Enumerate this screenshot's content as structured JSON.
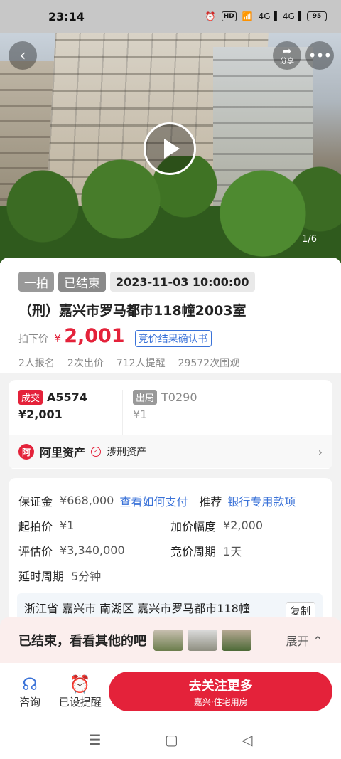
{
  "status_bar": {
    "time": "23:14",
    "hd": "HD",
    "battery": "95",
    "network1": "4G",
    "network2": "4G"
  },
  "hero": {
    "share_label": "分享",
    "counter": "1/6"
  },
  "auction": {
    "round_tag": "一拍",
    "status_tag": "已结束",
    "datetime": "2023-11-03 10:00:00",
    "title": "（刑）嘉兴市罗马都市118幢2003室",
    "price_label": "拍下价",
    "currency": "¥",
    "price": "2,001",
    "cert_link": "竞价结果确认书",
    "stats": [
      "2人报名",
      "2次出价",
      "712人提醒",
      "29572次围观"
    ]
  },
  "deal": {
    "winner_badge": "成交",
    "winner_code": "A5574",
    "winner_price": "¥2,001",
    "loser_badge": "出局",
    "loser_code": "T0290",
    "loser_price": "¥1",
    "platform_logo": "阿",
    "platform": "阿里资产",
    "category": "涉刑资产"
  },
  "info": {
    "deposit_label": "保证金",
    "deposit_value": "¥668,000",
    "pay_link": "查看如何支付",
    "recommend_label": "推荐",
    "recommend_link": "银行专用款项",
    "start_label": "起拍价",
    "start_value": "¥1",
    "increment_label": "加价幅度",
    "increment_value": "¥2,000",
    "appraisal_label": "评估价",
    "appraisal_value": "¥3,340,000",
    "period_label": "竞价周期",
    "period_value": "1天",
    "delay_label": "延时周期",
    "delay_value": "5分钟",
    "address": "浙江省 嘉兴市 南湖区 嘉兴市罗马都市118幢",
    "copy_label": "复制"
  },
  "ended_bar": {
    "text": "已结束，看看其他的吧",
    "expand_label": "展开"
  },
  "actions": {
    "consult_label": "咨询",
    "remind_label": "已设提醒",
    "follow_main": "去关注更多",
    "follow_sub": "嘉兴·住宅用房"
  },
  "colors": {
    "accent": "#e4223a",
    "link": "#3a72d8"
  }
}
